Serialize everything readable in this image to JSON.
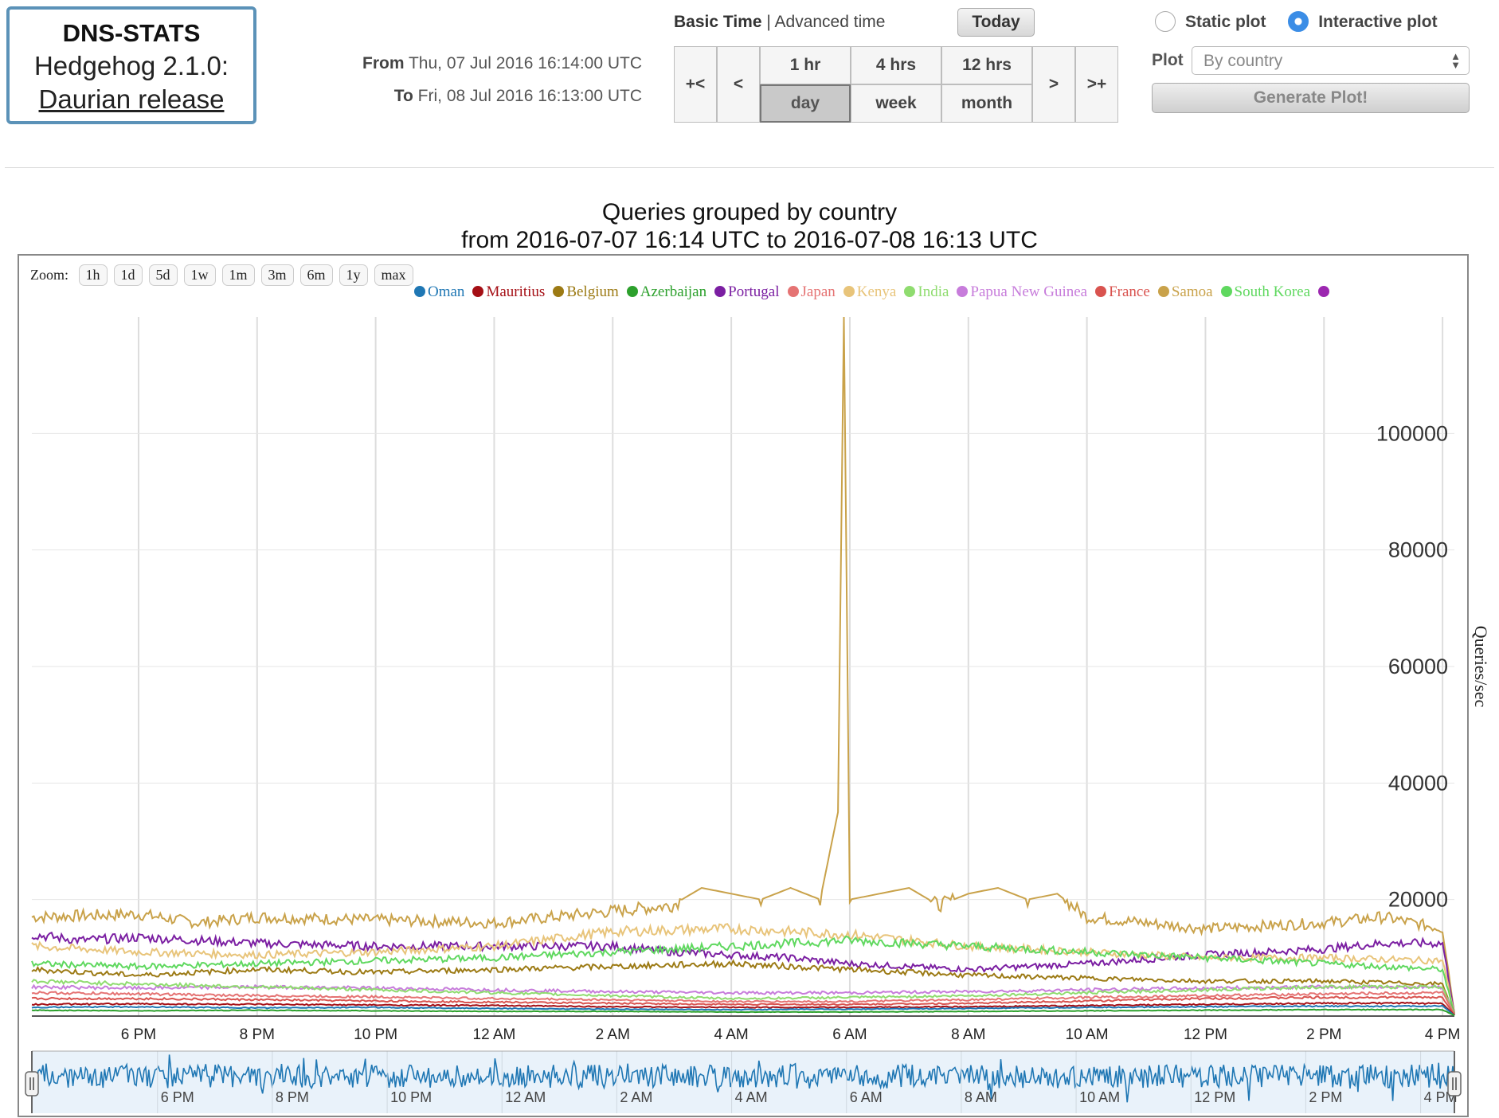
{
  "brand": {
    "name": "DNS-STATS",
    "version": "Hedgehog 2.1.0:",
    "release": "Daurian release"
  },
  "time": {
    "from_label": "From",
    "from_value": "Thu, 07 Jul 2016 16:14:00 UTC",
    "to_label": "To",
    "to_value": "Fri, 08 Jul 2016 16:13:00 UTC",
    "basic_label": "Basic Time",
    "separator": "|",
    "advanced_label": "Advanced time",
    "today_label": "Today",
    "nav": {
      "first": "+<",
      "prev": "<",
      "next": ">",
      "last": ">+",
      "hour1": "1 hr",
      "hours4": "4 hrs",
      "hours12": "12 hrs",
      "day": "day",
      "week": "week",
      "month": "month",
      "active": "day"
    }
  },
  "plot_controls": {
    "static_label": "Static plot",
    "interactive_label": "Interactive plot",
    "selected": "interactive",
    "plot_label": "Plot",
    "plot_value": "By country",
    "generate_label": "Generate Plot!"
  },
  "zoom": {
    "label": "Zoom:",
    "options": [
      "1h",
      "1d",
      "5d",
      "1w",
      "1m",
      "3m",
      "6m",
      "1y",
      "max"
    ]
  },
  "legend": [
    {
      "name": "Oman",
      "color": "#1f77b4"
    },
    {
      "name": "Mauritius",
      "color": "#a50f15"
    },
    {
      "name": "Belgium",
      "color": "#9c7a14"
    },
    {
      "name": "Azerbaijan",
      "color": "#2ca02c"
    },
    {
      "name": "Portugal",
      "color": "#7b1fa2"
    },
    {
      "name": "Japan",
      "color": "#e57373"
    },
    {
      "name": "Kenya",
      "color": "#e8c47a"
    },
    {
      "name": "India",
      "color": "#8fdc6f"
    },
    {
      "name": "Papua New Guinea",
      "color": "#c77cdb"
    },
    {
      "name": "France",
      "color": "#d9534f"
    },
    {
      "name": "Samoa",
      "color": "#c9a24a"
    },
    {
      "name": "South Korea",
      "color": "#5fd85f"
    },
    {
      "name": "",
      "color": "#9c27b0"
    }
  ],
  "chart_data": {
    "type": "line",
    "title": "Queries grouped by country",
    "subtitle": "from 2016-07-07 16:14 UTC to 2016-07-08 16:13 UTC",
    "ylabel": "Queries/sec",
    "ylim": [
      0,
      120000
    ],
    "yticks": [
      20000,
      40000,
      60000,
      80000,
      100000
    ],
    "xlim": [
      16.2,
      40.2
    ],
    "xticks": [
      {
        "x": 18,
        "label": "6 PM"
      },
      {
        "x": 20,
        "label": "8 PM"
      },
      {
        "x": 22,
        "label": "10 PM"
      },
      {
        "x": 24,
        "label": "12 AM"
      },
      {
        "x": 26,
        "label": "2 AM"
      },
      {
        "x": 28,
        "label": "4 AM"
      },
      {
        "x": 30,
        "label": "6 AM"
      },
      {
        "x": 32,
        "label": "8 AM"
      },
      {
        "x": 34,
        "label": "10 AM"
      },
      {
        "x": 36,
        "label": "12 PM"
      },
      {
        "x": 38,
        "label": "2 PM"
      },
      {
        "x": 40,
        "label": "4 PM"
      }
    ],
    "x_unit": "hours since 2016-07-07 00:00 UTC",
    "grid": true,
    "legend_position": "top",
    "series": [
      {
        "name": "Samoa",
        "color": "#c9a24a",
        "points": [
          [
            16.2,
            17000
          ],
          [
            18,
            17500
          ],
          [
            19,
            16000
          ],
          [
            20,
            17000
          ],
          [
            22,
            16500
          ],
          [
            24,
            16000
          ],
          [
            25,
            17000
          ],
          [
            26,
            18000
          ],
          [
            27,
            19000
          ],
          [
            27.5,
            22000
          ],
          [
            28,
            21000
          ],
          [
            28.5,
            20000
          ],
          [
            29,
            22000
          ],
          [
            29.5,
            20000
          ],
          [
            29.8,
            35000
          ],
          [
            29.9,
            120000
          ],
          [
            30,
            20000
          ],
          [
            31,
            22000
          ],
          [
            31.5,
            19000
          ],
          [
            32,
            21000
          ],
          [
            32.5,
            22000
          ],
          [
            33,
            20000
          ],
          [
            33.5,
            21000
          ],
          [
            34,
            17000
          ],
          [
            35,
            16000
          ],
          [
            36,
            15000
          ],
          [
            37,
            15500
          ],
          [
            38,
            16000
          ],
          [
            39,
            17000
          ],
          [
            40,
            15000
          ],
          [
            40.2,
            500
          ]
        ]
      },
      {
        "name": "Portugal",
        "color": "#7b1fa2",
        "points": [
          [
            16.2,
            14000
          ],
          [
            17,
            13000
          ],
          [
            18,
            13500
          ],
          [
            20,
            12500
          ],
          [
            22,
            12000
          ],
          [
            24,
            12000
          ],
          [
            26,
            12000
          ],
          [
            27,
            11000
          ],
          [
            28,
            10500
          ],
          [
            29,
            10000
          ],
          [
            30,
            9000
          ],
          [
            31,
            8500
          ],
          [
            32,
            8000
          ],
          [
            34,
            9000
          ],
          [
            36,
            10500
          ],
          [
            38,
            11500
          ],
          [
            39,
            12500
          ],
          [
            40,
            12500
          ],
          [
            40.2,
            500
          ]
        ]
      },
      {
        "name": "Kenya",
        "color": "#e8c47a",
        "points": [
          [
            16.2,
            12000
          ],
          [
            18,
            11000
          ],
          [
            20,
            10500
          ],
          [
            22,
            11000
          ],
          [
            24,
            12000
          ],
          [
            26,
            14500
          ],
          [
            28,
            15000
          ],
          [
            30,
            14000
          ],
          [
            32,
            12000
          ],
          [
            34,
            11000
          ],
          [
            36,
            10000
          ],
          [
            38,
            10000
          ],
          [
            40,
            9500
          ],
          [
            40.2,
            500
          ]
        ]
      },
      {
        "name": "South Korea",
        "color": "#5fd85f",
        "points": [
          [
            16.2,
            9000
          ],
          [
            18,
            8500
          ],
          [
            20,
            9000
          ],
          [
            22,
            9500
          ],
          [
            24,
            10000
          ],
          [
            26,
            11000
          ],
          [
            28,
            12000
          ],
          [
            30,
            13000
          ],
          [
            32,
            12000
          ],
          [
            34,
            11000
          ],
          [
            36,
            10000
          ],
          [
            38,
            9000
          ],
          [
            40,
            8000
          ],
          [
            40.2,
            300
          ]
        ]
      },
      {
        "name": "Belgium",
        "color": "#9c7a14",
        "points": [
          [
            16.2,
            8000
          ],
          [
            18,
            7000
          ],
          [
            20,
            8000
          ],
          [
            22,
            7500
          ],
          [
            24,
            8000
          ],
          [
            26,
            8500
          ],
          [
            28,
            9000
          ],
          [
            30,
            8000
          ],
          [
            32,
            7000
          ],
          [
            34,
            6500
          ],
          [
            36,
            6000
          ],
          [
            38,
            6000
          ],
          [
            40,
            5500
          ],
          [
            40.2,
            300
          ]
        ]
      },
      {
        "name": "Papua New Guinea",
        "color": "#c77cdb",
        "points": [
          [
            16.2,
            5000
          ],
          [
            18,
            4800
          ],
          [
            20,
            5000
          ],
          [
            22,
            4800
          ],
          [
            24,
            4500
          ],
          [
            26,
            4200
          ],
          [
            28,
            4000
          ],
          [
            30,
            4000
          ],
          [
            32,
            4200
          ],
          [
            34,
            4500
          ],
          [
            36,
            4800
          ],
          [
            38,
            5000
          ],
          [
            40,
            5000
          ],
          [
            40.2,
            300
          ]
        ]
      },
      {
        "name": "India",
        "color": "#8fdc6f",
        "points": [
          [
            16.2,
            6000
          ],
          [
            18,
            5500
          ],
          [
            20,
            5000
          ],
          [
            22,
            4500
          ],
          [
            24,
            4000
          ],
          [
            26,
            3500
          ],
          [
            28,
            3000
          ],
          [
            30,
            3200
          ],
          [
            32,
            3500
          ],
          [
            34,
            4000
          ],
          [
            36,
            4500
          ],
          [
            38,
            5000
          ],
          [
            40,
            5000
          ],
          [
            40.2,
            200
          ]
        ]
      },
      {
        "name": "Japan",
        "color": "#e57373",
        "points": [
          [
            16.2,
            4000
          ],
          [
            18,
            3800
          ],
          [
            20,
            3500
          ],
          [
            22,
            3300
          ],
          [
            24,
            3000
          ],
          [
            26,
            2800
          ],
          [
            28,
            2500
          ],
          [
            30,
            2500
          ],
          [
            32,
            2800
          ],
          [
            34,
            3200
          ],
          [
            36,
            3500
          ],
          [
            38,
            3800
          ],
          [
            40,
            4000
          ],
          [
            40.2,
            200
          ]
        ]
      },
      {
        "name": "France",
        "color": "#d9534f",
        "points": [
          [
            16.2,
            3000
          ],
          [
            18,
            3000
          ],
          [
            20,
            2800
          ],
          [
            22,
            2600
          ],
          [
            24,
            2400
          ],
          [
            26,
            2200
          ],
          [
            28,
            2000
          ],
          [
            30,
            2000
          ],
          [
            32,
            2200
          ],
          [
            34,
            2600
          ],
          [
            36,
            3000
          ],
          [
            38,
            3200
          ],
          [
            40,
            3200
          ],
          [
            40.2,
            200
          ]
        ]
      },
      {
        "name": "Mauritius",
        "color": "#a50f15",
        "points": [
          [
            16.2,
            2000
          ],
          [
            18,
            2100
          ],
          [
            20,
            2000
          ],
          [
            22,
            1900
          ],
          [
            24,
            1800
          ],
          [
            26,
            1600
          ],
          [
            28,
            1500
          ],
          [
            30,
            1500
          ],
          [
            32,
            1600
          ],
          [
            34,
            1800
          ],
          [
            36,
            2000
          ],
          [
            38,
            2200
          ],
          [
            40,
            2200
          ],
          [
            40.2,
            100
          ]
        ]
      },
      {
        "name": "Oman",
        "color": "#1f77b4",
        "points": [
          [
            16.2,
            1500
          ],
          [
            18,
            1600
          ],
          [
            20,
            1400
          ],
          [
            22,
            1500
          ],
          [
            24,
            1300
          ],
          [
            26,
            1200
          ],
          [
            28,
            1100
          ],
          [
            30,
            1200
          ],
          [
            32,
            1300
          ],
          [
            34,
            1500
          ],
          [
            36,
            1600
          ],
          [
            38,
            1700
          ],
          [
            40,
            1700
          ],
          [
            40.2,
            100
          ]
        ]
      },
      {
        "name": "Azerbaijan",
        "color": "#2ca02c",
        "points": [
          [
            16.2,
            1000
          ],
          [
            18,
            900
          ],
          [
            20,
            1000
          ],
          [
            22,
            900
          ],
          [
            24,
            800
          ],
          [
            26,
            800
          ],
          [
            28,
            700
          ],
          [
            30,
            700
          ],
          [
            32,
            800
          ],
          [
            34,
            900
          ],
          [
            36,
            1000
          ],
          [
            38,
            1100
          ],
          [
            40,
            1100
          ],
          [
            40.2,
            100
          ]
        ]
      }
    ],
    "navigator": {
      "color": "#1f77b4",
      "xticks": [
        "6 PM",
        "8 PM",
        "10 PM",
        "12 AM",
        "2 AM",
        "4 AM",
        "6 AM",
        "8 AM",
        "10 AM",
        "12 PM",
        "2 PM",
        "4 PM"
      ]
    }
  }
}
